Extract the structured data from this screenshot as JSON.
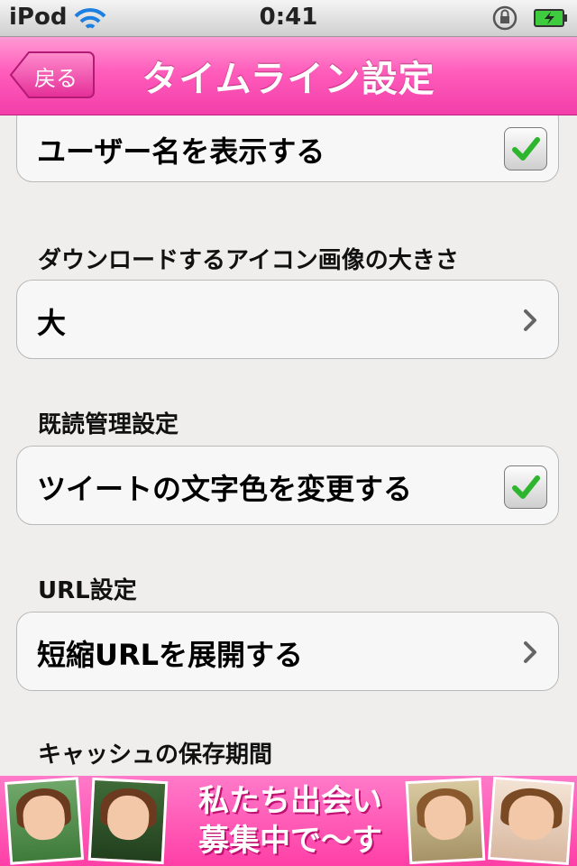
{
  "status_bar": {
    "carrier": "iPod",
    "time": "0:41"
  },
  "nav": {
    "back_label": "戻る",
    "title": "タイムライン設定"
  },
  "cells": {
    "show_username": {
      "label": "ユーザー名を表示する",
      "checked": true
    },
    "icon_size": {
      "header": "ダウンロードするアイコン画像の大きさ",
      "value": "大"
    },
    "read_management": {
      "header": "既読管理設定",
      "label": "ツイートの文字色を変更する",
      "checked": true
    },
    "url_settings": {
      "header": "URL設定",
      "label": "短縮URLを展開する"
    },
    "cache": {
      "header": "キャッシュの保存期間"
    }
  },
  "banner": {
    "line1": "私たち出会い",
    "line2": "募集中で～す"
  },
  "colors": {
    "nav_pink": "#ff5cbb",
    "background": "#efeeec",
    "check_green": "#2db52d",
    "banner_pink": "#ff3fa6"
  },
  "icons": [
    "wifi-icon",
    "rotation-lock-icon",
    "battery-icon",
    "checkmark-icon",
    "chevron-right-icon"
  ]
}
